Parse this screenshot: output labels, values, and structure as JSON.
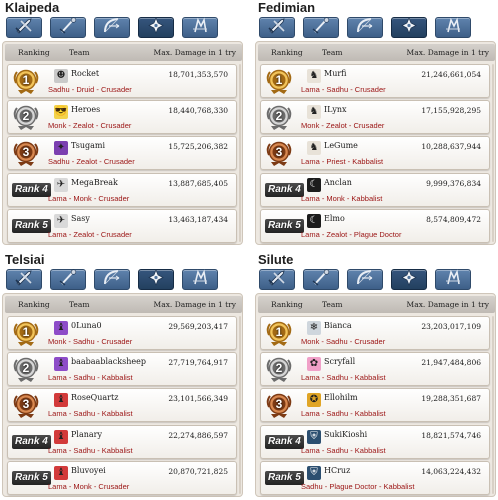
{
  "header_labels": {
    "ranking": "Ranking",
    "team": "Team",
    "damage": "Max. Damage in 1 try"
  },
  "tabs": [
    {
      "icon": "sword-icon"
    },
    {
      "icon": "staff-icon"
    },
    {
      "icon": "bow-icon"
    },
    {
      "icon": "cross-icon"
    },
    {
      "icon": "scout-icon"
    }
  ],
  "active_tab": 3,
  "colors": {
    "tab": "#4f729c",
    "tab_active": "#2b4a6e",
    "class_text": "#9b1414",
    "gold": "#c8952f",
    "silver": "#9a9a9a",
    "bronze": "#a85a2a"
  },
  "panels": [
    {
      "server": "Klaipeda",
      "rows": [
        {
          "rank": "1",
          "medal": "gold",
          "name": "Rocket",
          "damage": "18,701,353,570",
          "classes": "Sadhu - Druid - Crusader",
          "avatar": "ghost-icon",
          "avatar_glyph": "☻",
          "avatar_bg": "#c9c9c9"
        },
        {
          "rank": "2",
          "medal": "silver",
          "name": "Heroes",
          "damage": "18,440,768,330",
          "classes": "Monk - Zealot - Crusader",
          "avatar": "sunglasses-face-icon",
          "avatar_glyph": "😎",
          "avatar_bg": "#f3d34a"
        },
        {
          "rank": "3",
          "medal": "bronze",
          "name": "Tsugami",
          "damage": "15,725,206,382",
          "classes": "Sadhu - Zealot - Crusader",
          "avatar": "purple-emblem-icon",
          "avatar_glyph": "✦",
          "avatar_bg": "#7b3fb0"
        },
        {
          "rank": "Rank 4",
          "medal": "none",
          "name": "MegaBreak",
          "damage": "13,887,685,405",
          "classes": "Lama - Monk - Crusader",
          "avatar": "bird-icon",
          "avatar_glyph": "✈",
          "avatar_bg": "#d9d9d9"
        },
        {
          "rank": "Rank 5",
          "medal": "none",
          "name": "Sasy",
          "damage": "13,463,187,434",
          "classes": "Lama - Zealot - Crusader",
          "avatar": "bird-icon",
          "avatar_glyph": "✈",
          "avatar_bg": "#d9d9d9"
        }
      ]
    },
    {
      "server": "Fedimian",
      "rows": [
        {
          "rank": "1",
          "medal": "gold",
          "name": "Murfi",
          "damage": "21,246,661,054",
          "classes": "Lama - Sadhu - Crusader",
          "avatar": "horse-icon",
          "avatar_glyph": "♞",
          "avatar_bg": "#e8e2d8"
        },
        {
          "rank": "2",
          "medal": "silver",
          "name": "ILynx",
          "damage": "17,155,928,295",
          "classes": "Monk - Zealot - Crusader",
          "avatar": "horse-icon",
          "avatar_glyph": "♞",
          "avatar_bg": "#e8e2d8"
        },
        {
          "rank": "3",
          "medal": "bronze",
          "name": "LeGume",
          "damage": "10,288,637,944",
          "classes": "Lama - Priest - Kabbalist",
          "avatar": "horse-icon",
          "avatar_glyph": "♞",
          "avatar_bg": "#e8e2d8"
        },
        {
          "rank": "Rank 4",
          "medal": "none",
          "name": "Anclan",
          "damage": "9,999,376,834",
          "classes": "Lama - Monk - Kabbalist",
          "avatar": "moon-icon",
          "avatar_glyph": "☾",
          "avatar_bg": "#1c1c1c"
        },
        {
          "rank": "Rank 5",
          "medal": "none",
          "name": "Elmo",
          "damage": "8,574,809,472",
          "classes": "Lama - Zealot - Plague Doctor",
          "avatar": "moon-icon",
          "avatar_glyph": "☾",
          "avatar_bg": "#1c1c1c"
        }
      ]
    },
    {
      "server": "Telsiai",
      "rows": [
        {
          "rank": "1",
          "medal": "gold",
          "name": "0Luna0",
          "damage": "29,569,203,417",
          "classes": "Monk - Sadhu - Crusader",
          "avatar": "purple-crane-icon",
          "avatar_glyph": "♝",
          "avatar_bg": "#8d4cc8"
        },
        {
          "rank": "2",
          "medal": "silver",
          "name": "baabaablacksheep",
          "damage": "27,719,764,917",
          "classes": "Lama - Sadhu - Kabbalist",
          "avatar": "purple-crane-icon",
          "avatar_glyph": "♝",
          "avatar_bg": "#8d4cc8"
        },
        {
          "rank": "3",
          "medal": "bronze",
          "name": "RoseQuartz",
          "damage": "23,101,566,349",
          "classes": "Lama - Sadhu - Kabbalist",
          "avatar": "red-crane-icon",
          "avatar_glyph": "♝",
          "avatar_bg": "#d23a3a"
        },
        {
          "rank": "Rank 4",
          "medal": "none",
          "name": "Planary",
          "damage": "22,274,886,597",
          "classes": "Lama - Sadhu - Kabbalist",
          "avatar": "red-crane-icon",
          "avatar_glyph": "♝",
          "avatar_bg": "#d23a3a"
        },
        {
          "rank": "Rank 5",
          "medal": "none",
          "name": "Bluvoyei",
          "damage": "20,870,721,825",
          "classes": "Lama - Monk - Crusader",
          "avatar": "red-crane-icon",
          "avatar_glyph": "♝",
          "avatar_bg": "#d23a3a"
        }
      ]
    },
    {
      "server": "Silute",
      "rows": [
        {
          "rank": "1",
          "medal": "gold",
          "name": "Bianca",
          "damage": "23,203,017,109",
          "classes": "Monk - Sadhu - Crusader",
          "avatar": "snowflake-icon",
          "avatar_glyph": "❄",
          "avatar_bg": "#cfd6dd"
        },
        {
          "rank": "2",
          "medal": "silver",
          "name": "Scryfall",
          "damage": "21,947,484,806",
          "classes": "Lama - Sadhu - Kabbalist",
          "avatar": "pink-creature-icon",
          "avatar_glyph": "✿",
          "avatar_bg": "#f0a0c8"
        },
        {
          "rank": "3",
          "medal": "bronze",
          "name": "Ellohilm",
          "damage": "19,288,351,687",
          "classes": "Lama - Sadhu - Kabbalist",
          "avatar": "gold-emblem-icon",
          "avatar_glyph": "✪",
          "avatar_bg": "#e0a526"
        },
        {
          "rank": "Rank 4",
          "medal": "none",
          "name": "SukiKioshi",
          "damage": "18,821,574,746",
          "classes": "Lama - Sadhu - Kabbalist",
          "avatar": "shield-icon",
          "avatar_glyph": "⛨",
          "avatar_bg": "#2c4f70"
        },
        {
          "rank": "Rank 5",
          "medal": "none",
          "name": "HCruz",
          "damage": "14,063,224,432",
          "classes": "Sadhu - Plague Doctor - Kabbalist",
          "avatar": "shield-icon",
          "avatar_glyph": "⛨",
          "avatar_bg": "#2c4f70"
        }
      ]
    }
  ]
}
